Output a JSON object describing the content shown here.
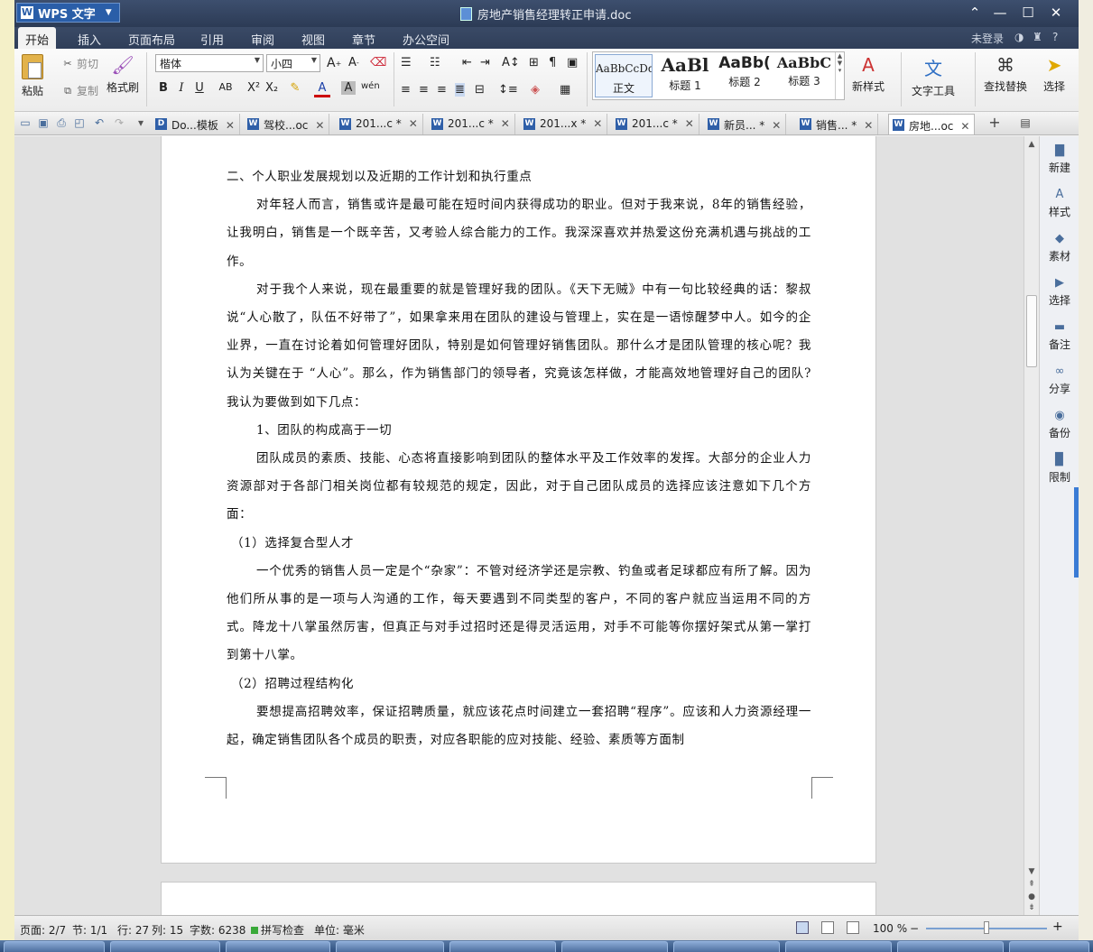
{
  "window": {
    "app_name": "WPS 文字",
    "doc_title": "房地产销售经理转正申请.doc",
    "controls": {
      "minimize": "—",
      "maximize": "☐",
      "close": "✕",
      "ribbon_collapse": "⌃"
    }
  },
  "menu": {
    "items": [
      "开始",
      "插入",
      "页面布局",
      "引用",
      "审阅",
      "视图",
      "章节",
      "办公空间"
    ],
    "active": "开始",
    "login": "未登录",
    "help": "?"
  },
  "ribbon": {
    "paste": "粘贴",
    "cut": "剪切",
    "copy": "复制",
    "format_painter": "格式刷",
    "font_name": "楷体",
    "font_size": "小四",
    "styles": [
      {
        "sample": "AaBbCcDd",
        "label": "正文"
      },
      {
        "sample": "AaBl",
        "label": "标题 1"
      },
      {
        "sample": "AaBb(",
        "label": "标题 2"
      },
      {
        "sample": "AaBbC",
        "label": "标题 3"
      }
    ],
    "new_style": "新样式",
    "text_tools": "文字工具",
    "find_replace": "查找替换",
    "select": "选择"
  },
  "tabs": [
    {
      "label": "Do...模板",
      "icon": "D"
    },
    {
      "label": "驾校...oc",
      "icon": "W"
    },
    {
      "label": "201...c *",
      "icon": "W"
    },
    {
      "label": "201...c *",
      "icon": "W"
    },
    {
      "label": "201...x *",
      "icon": "W"
    },
    {
      "label": "201...c *",
      "icon": "W"
    },
    {
      "label": "新员... *",
      "icon": "W"
    },
    {
      "label": "销售... *",
      "icon": "W"
    },
    {
      "label": "房地...oc",
      "icon": "W",
      "active": true
    }
  ],
  "document": {
    "paragraphs": [
      {
        "style": "head",
        "text": "二、个人职业发展规划以及近期的工作计划和执行重点"
      },
      {
        "style": "indent",
        "text": "对年轻人而言，销售或许是最可能在短时间内获得成功的职业。但对于我来说，8年的销售经验，让我明白，销售是一个既辛苦，又考验人综合能力的工作。我深深喜欢并热爱这份充满机遇与挑战的工作。"
      },
      {
        "style": "indent",
        "text": "对于我个人来说，现在最重要的就是管理好我的团队。《天下无贼》中有一句比较经典的话：黎叔说“人心散了，队伍不好带了”，如果拿来用在团队的建设与管理上，实在是一语惊醒梦中人。如今的企业界，一直在讨论着如何管理好团队，特别是如何管理好销售团队。那什么才是团队管理的核心呢？我认为关键在于 “人心”。那么，作为销售部门的领导者，究竟该怎样做，才能高效地管理好自己的团队?我认为要做到如下几点："
      },
      {
        "style": "sub",
        "text": "1、团队的构成高于一切"
      },
      {
        "style": "indent",
        "text": "团队成员的素质、技能、心态将直接影响到团队的整体水平及工作效率的发挥。大部分的企业人力资源部对于各部门相关岗位都有较规范的规定，因此，对于自己团队成员的选择应该注意如下几个方面："
      },
      {
        "style": "num",
        "text": "（1）选择复合型人才"
      },
      {
        "style": "indent",
        "text": "一个优秀的销售人员一定是个“杂家”：不管对经济学还是宗教、钓鱼或者足球都应有所了解。因为他们所从事的是一项与人沟通的工作，每天要遇到不同类型的客户，不同的客户就应当运用不同的方式。降龙十八掌虽然厉害，但真正与对手过招时还是得灵活运用，对手不可能等你摆好架式从第一掌打到第十八掌。"
      },
      {
        "style": "num",
        "text": "（2）招聘过程结构化"
      },
      {
        "style": "indent",
        "text": "要想提高招聘效率，保证招聘质量，就应该花点时间建立一套招聘“程序”。应该和人力资源经理一起，确定销售团队各个成员的职责，对应各职能的应对技能、经验、素质等方面制"
      }
    ]
  },
  "task_panel": [
    "新建",
    "样式",
    "素材",
    "选择",
    "备注",
    "分享",
    "备份",
    "限制"
  ],
  "status": {
    "page": "页面: 2/7",
    "section": "节: 1/1",
    "row": "行: 27",
    "col": "列: 15",
    "words": "字数: 6238",
    "spell": "拼写检查",
    "unit": "单位: 毫米",
    "zoom": "100 %",
    "zoom_level": 0.5
  },
  "colors": {
    "accent": "#2a5ea8",
    "titlebar": "#2c3b55"
  }
}
